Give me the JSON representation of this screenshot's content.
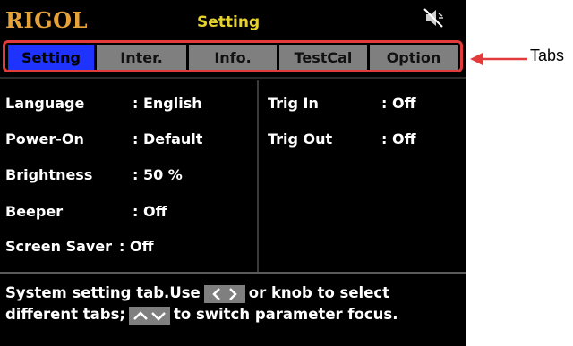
{
  "header": {
    "logo": "RIGOL",
    "title": "Setting",
    "mute_icon": "speaker-muted-icon"
  },
  "tabs": [
    {
      "label": "Setting",
      "active": true
    },
    {
      "label": "Inter.",
      "active": false
    },
    {
      "label": "Info.",
      "active": false
    },
    {
      "label": "TestCal",
      "active": false
    },
    {
      "label": "Option",
      "active": false
    }
  ],
  "left_params": [
    {
      "label": "Language",
      "value": ": English"
    },
    {
      "label": "Power-On",
      "value": ": Default"
    },
    {
      "label": "Brightness",
      "value": ": 50 %"
    },
    {
      "label": "Beeper",
      "value": ": Off"
    },
    {
      "label": "Screen Saver",
      "value": ": Off"
    }
  ],
  "right_params": [
    {
      "label": "Trig In",
      "value": ": Off"
    },
    {
      "label": "Trig Out",
      "value": ": Off"
    }
  ],
  "help": {
    "line1_a": "System setting tab.Use",
    "line1_b": "or knob to select",
    "line2_a": "different tabs;",
    "line2_b": "to switch parameter focus.",
    "icon_lr": "left-right-arrows-icon",
    "icon_ud": "up-down-arrows-icon"
  },
  "annotation": {
    "label": "Tabs",
    "color": "#e23b3b"
  }
}
